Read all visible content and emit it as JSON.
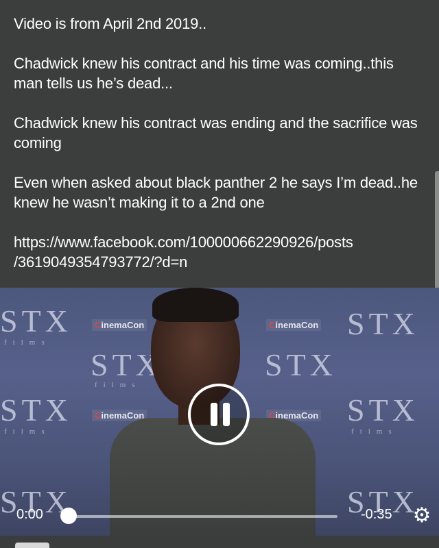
{
  "post": {
    "paragraphs": [
      "Video is from April 2nd 2019..",
      "Chadwick knew his contract and his time was coming..this\nman tells us he’s dead...",
      "Chadwick knew his contract was ending and the sacrifice was\ncoming",
      "Even when asked about black panther 2 he says I’m dead..he\nknew he wasn’t making it to a 2nd one",
      "https://www.facebook.com/100000662290926/posts\n/3619049354793772/?d=n"
    ]
  },
  "video": {
    "backdrop_brand": "STX",
    "backdrop_sub": "films",
    "sponsor_c": "C",
    "sponsor_rest": "inemaCon",
    "current_time": "0:00",
    "remaining_time": "-0:35",
    "progress": 0.0,
    "play_state": "paused-icon-shown",
    "icons": {
      "pause": "pause-icon",
      "settings": "gear-icon"
    }
  },
  "colors": {
    "background": "#3b3e3c",
    "text": "#ffffff"
  }
}
